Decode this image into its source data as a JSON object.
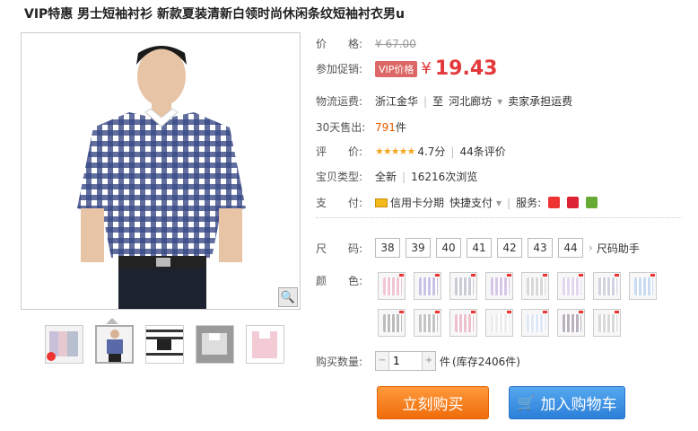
{
  "title": "VIP特惠 男士短袖衬衫 新款夏装清新白领时尚休闲条纹短袖衬衣男u",
  "price": {
    "label": "价　　格:",
    "currency": "¥",
    "original": "67.00"
  },
  "promo": {
    "label": "参加促销:",
    "badge": "VIP价格",
    "currency": "¥",
    "price": "19.43"
  },
  "shipping": {
    "label": "物流运费:",
    "from": "浙江金华",
    "to_prefix": "至",
    "to": "河北廊坊",
    "fee": "卖家承担运费"
  },
  "sales": {
    "label": "30天售出:",
    "count": "791",
    "unit": "件"
  },
  "rating": {
    "label": "评　　价:",
    "stars": "★★★★★",
    "score": "4.7分",
    "reviews": "44条评价"
  },
  "item_type": {
    "label": "宝贝类型:",
    "condition": "全新",
    "views": "16216次浏览"
  },
  "payment": {
    "label": "支　　付:",
    "method1": "信用卡分期",
    "method2": "快捷支付",
    "service_label": "服务:"
  },
  "sizes": {
    "label": "尺　　码:",
    "options": [
      "38",
      "39",
      "40",
      "41",
      "42",
      "43",
      "44"
    ],
    "helper": "尺码助手"
  },
  "colors": {
    "label": "颜　　色:",
    "swatches": [
      "#f1c6d4",
      "#c9c2e6",
      "#c9cbd6",
      "#d6c6e8",
      "#d8d8d8",
      "#e3d6ef",
      "#d0d2df",
      "#c9dbf3",
      "#bcbcbc",
      "#c4c4c4",
      "#ecc0cc",
      "#ededed",
      "#dfe8f6",
      "#b9b2bc",
      "#d9d9d9"
    ]
  },
  "quantity": {
    "label": "购买数量:",
    "value": "1",
    "unit": "件",
    "stock": "(库存2406件)"
  },
  "buttons": {
    "buy": "立刻购买",
    "cart": "加入购物车"
  }
}
